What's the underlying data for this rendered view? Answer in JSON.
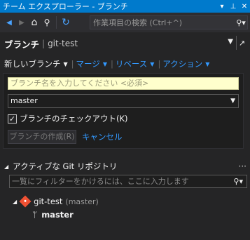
{
  "titlebar": {
    "title": "チーム エクスプローラー - ブランチ",
    "dropdown_glyph": "▾",
    "pin_glyph": "⊥",
    "close_glyph": "✕"
  },
  "toolbar": {
    "back_glyph": "◀",
    "forward_glyph": "▶",
    "home_glyph": "⌂",
    "connect_glyph": "⚲",
    "refresh_glyph": "↻",
    "search": {
      "placeholder": "作業項目の検索 (Ctrl+^)",
      "icon_glyph": "⚲▾"
    }
  },
  "header": {
    "title": "ブランチ",
    "separator": "|",
    "repo": "git-test",
    "dropdown_glyph": "▼",
    "external_glyph": "↗"
  },
  "actions": [
    {
      "label": "新しいブランチ",
      "link": false
    },
    {
      "label": "マージ",
      "link": true
    },
    {
      "label": "リベース",
      "link": true
    },
    {
      "label": "アクション",
      "link": true
    }
  ],
  "caret_glyph": "▼",
  "separator_glyph": "|",
  "form": {
    "name_placeholder": "ブランチ名を入力してください <必須>",
    "base_branch": "master",
    "select_caret": "▼",
    "checkout_checked_glyph": "✓",
    "checkout_label": "ブランチのチェックアウト(K)",
    "create_label": "ブランチの作成(R)",
    "cancel_label": "キャンセル"
  },
  "section": {
    "caret": "◢",
    "title": "アクティブな Git リポジトリ",
    "more_glyph": "···"
  },
  "filter": {
    "placeholder": "一覧にフィルターをかけるには、ここに入力します",
    "icon_glyph": "⚲▾"
  },
  "repo": {
    "caret": "◢",
    "name": "git-test",
    "branch_label": "(master)"
  },
  "branch": {
    "icon_glyph": "ᛘ",
    "name": "master"
  },
  "colors": {
    "accent": "#007acc",
    "link": "#3399ff",
    "background": "#252526",
    "git_brand": "#f05133",
    "input_highlight": "#ffffcc"
  }
}
